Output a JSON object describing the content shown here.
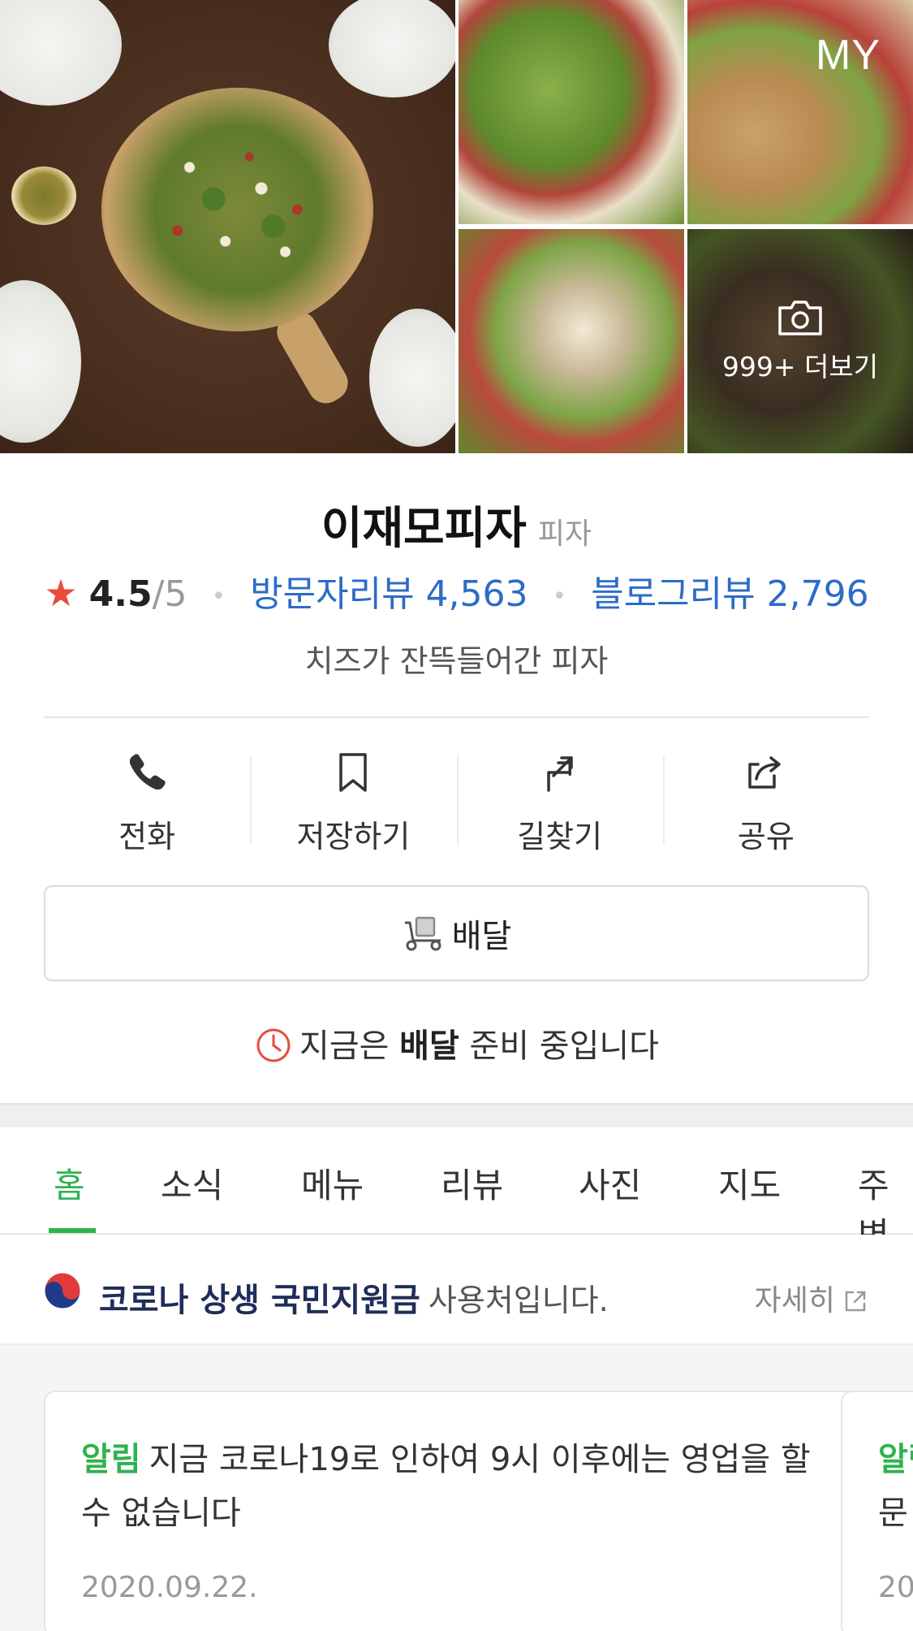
{
  "header": {
    "my_label": "MY",
    "more_photos_label": "999+ 더보기",
    "icons": {
      "camera": "camera-icon"
    }
  },
  "place": {
    "name": "이재모피자",
    "category": "피자",
    "rating": "4.5",
    "rating_max": "/5",
    "visitor_reviews_label": "방문자리뷰 4,563",
    "blog_reviews_label": "블로그리뷰 2,796",
    "description": "치즈가 잔뜩들어간 피자"
  },
  "actions": [
    {
      "label": "전화",
      "icon": "phone-icon"
    },
    {
      "label": "저장하기",
      "icon": "bookmark-icon"
    },
    {
      "label": "길찾기",
      "icon": "directions-icon"
    },
    {
      "label": "공유",
      "icon": "share-icon"
    }
  ],
  "delivery": {
    "label": "배달",
    "status_prefix": "지금은",
    "status_bold": "배달",
    "status_suffix": "준비 중입니다"
  },
  "tabs": [
    "홈",
    "소식",
    "메뉴",
    "리뷰",
    "사진",
    "지도",
    "주변"
  ],
  "active_tab": "홈",
  "notice": {
    "bold": "코로나 상생 국민지원금",
    "rest": "사용처입니다.",
    "more": "자세히"
  },
  "cards": [
    {
      "tag": "알림",
      "text": "지금 코로나19로 인하여 9시 이후에는 영업을 할 수 없습니다",
      "date": "2020.09.22."
    },
    {
      "tag": "알림",
      "text": "문",
      "date": "20"
    }
  ],
  "colors": {
    "accent_green": "#30b24f",
    "link_blue": "#2d6bc8",
    "star_red": "#e94c3c",
    "gov_navy": "#1f2d5a"
  }
}
